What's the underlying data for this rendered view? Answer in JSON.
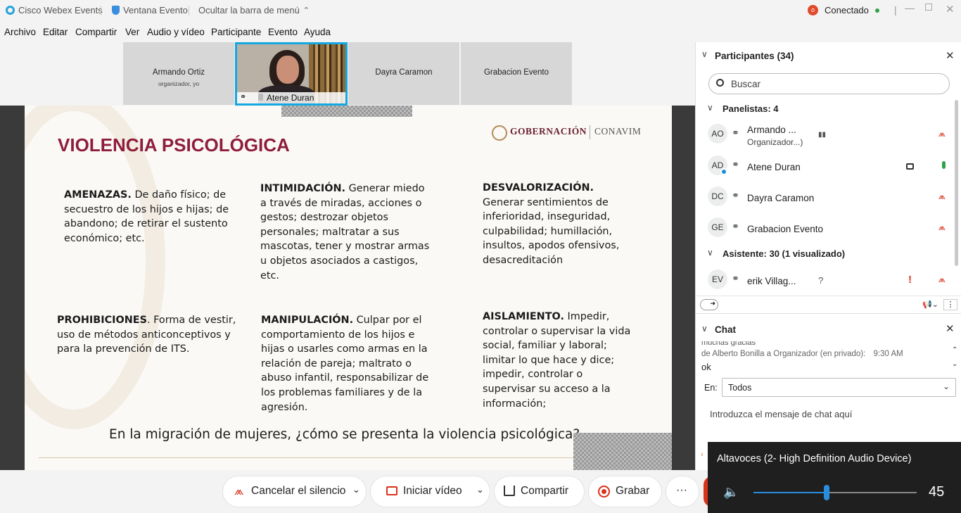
{
  "titlebar": {
    "app_name": "Cisco Webex Events",
    "window_label": "Ventana Evento",
    "hide_menu": "Ocultar la barra de menú",
    "status": "Conectado"
  },
  "menu": [
    "Archivo",
    "Editar",
    "Compartir",
    "Ver",
    "Audio y vídeo",
    "Participante",
    "Evento",
    "Ayuda"
  ],
  "video_tiles": [
    {
      "name": "Armando Ortiz",
      "sub": "organizador, yo"
    },
    {
      "name": "Atene Duran",
      "sub": ""
    },
    {
      "name": "Dayra Caramon",
      "sub": ""
    },
    {
      "name": "Grabacion Evento",
      "sub": ""
    }
  ],
  "slide": {
    "title": "VIOLENCIA PSICOLÓGICA",
    "logo_left": "GOBERNACIÓN",
    "logo_right": "CONAVIM",
    "blocks": [
      {
        "head": "AMENAZAS.",
        "body": " De daño físico; de secuestro de los hijos e hijas; de abandono; de retirar el sustento económico; etc."
      },
      {
        "head": "INTIMIDACIÓN.",
        "body": " Generar miedo a través de miradas, acciones o gestos; destrozar objetos personales; maltratar a sus mascotas, tener y mostrar armas u objetos asociados a castigos, etc."
      },
      {
        "head": "DESVALORIZACIÓN.",
        "body": " Generar sentimientos de inferioridad, inseguridad, culpabilidad; humillación, insultos, apodos ofensivos, desacreditación"
      },
      {
        "head": "PROHIBICIONES",
        "body": ". Forma de vestir, uso de métodos anticonceptivos y para la prevención de ITS."
      },
      {
        "head": "MANIPULACIÓN.",
        "body": " Culpar por el comportamiento de los hijos e hijas o usarles como armas en la relación de pareja; maltrato o abuso infantil, responsabilizar de los problemas familiares y de la agresión."
      },
      {
        "head": "AISLAMIENTO.",
        "body": " Impedir, controlar o supervisar la vida social, familiar y laboral; limitar lo que hace y dice; impedir, controlar o supervisar su acceso a la información;"
      }
    ],
    "question": "En la migración de mujeres, ¿cómo se presenta la violencia psicológica?"
  },
  "participants": {
    "header": "Participantes (34)",
    "search_placeholder": "Buscar",
    "panelists_label": "Panelistas: 4",
    "attendees_label": "Asistente: 30 (1 visualizado)",
    "panelists": [
      {
        "initials": "AO",
        "name": "Armando ...",
        "sub": "Organizador...)"
      },
      {
        "initials": "AD",
        "name": "Atene Duran",
        "sub": ""
      },
      {
        "initials": "DC",
        "name": "Dayra Caramon",
        "sub": ""
      },
      {
        "initials": "GE",
        "name": "Grabacion Evento",
        "sub": ""
      }
    ],
    "attendees": [
      {
        "initials": "EV",
        "name": "erik Villag...",
        "sub": ""
      }
    ]
  },
  "chat": {
    "header": "Chat",
    "partial_msg": "muchas gracias",
    "msg_from": "de Alberto Bonilla a Organizador (en privado):",
    "msg_time": "9:30 AM",
    "msg_text": "ok",
    "to_label": "En:",
    "to_value": "Todos",
    "input_placeholder": "Introduzca el mensaje de chat aquí"
  },
  "controls": {
    "mute": "Cancelar el silencio",
    "video": "Iniciar vídeo",
    "share": "Compartir",
    "record": "Grabar",
    "more": "···"
  },
  "volume": {
    "device": "Altavoces (2- High Definition Audio Device)",
    "level": 45
  },
  "colors": {
    "accent": "#1170cf",
    "slide_title": "#8f1d3c",
    "mute_red": "#d9331c",
    "status_green": "#2ea34a"
  }
}
